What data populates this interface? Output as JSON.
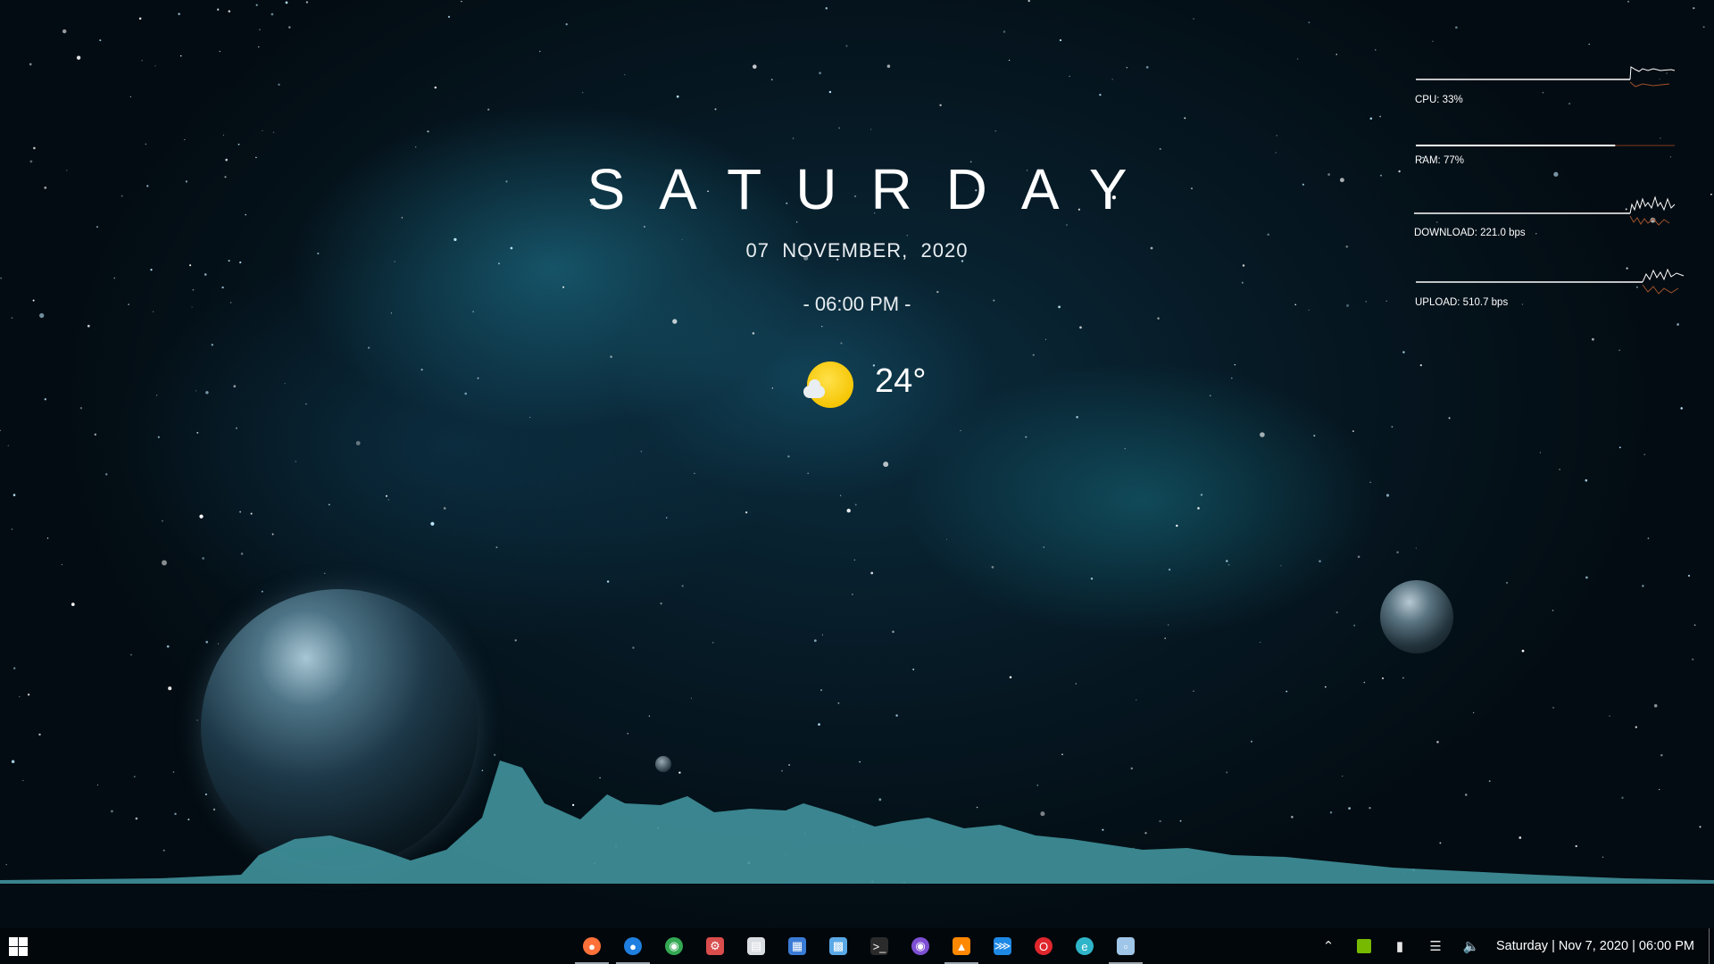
{
  "widget": {
    "day": "SATURDAY",
    "date": "07  NOVEMBER,  2020",
    "time": "- 06:00 PM -",
    "weather": {
      "temperature": "24°",
      "icon": "sun-cloud-icon"
    }
  },
  "system_monitor": [
    {
      "label": "CPU: 33%",
      "value": 33,
      "color": "#ffffff"
    },
    {
      "label": "RAM: 77%",
      "value": 77,
      "color": "#ffffff"
    },
    {
      "label": "DOWNLOAD: 221.0 bps"
    },
    {
      "label": "UPLOAD: 510.7 bps"
    }
  ],
  "taskbar": {
    "apps": [
      {
        "name": "firefox",
        "icon": "firefox-icon",
        "color": "#ff7139",
        "active": true
      },
      {
        "name": "firefox-developer",
        "icon": "firefox-developer-icon",
        "color": "#1f7fe0",
        "active": true
      },
      {
        "name": "chrome",
        "icon": "chrome-icon",
        "color": "#34a853",
        "active": false
      },
      {
        "name": "settings-app",
        "icon": "gear-icon",
        "color": "#d94d4d",
        "active": false
      },
      {
        "name": "notepad",
        "icon": "notepad-icon",
        "color": "#d8dde2",
        "active": false
      },
      {
        "name": "calculator",
        "icon": "calculator-icon",
        "color": "#3a7bd5",
        "active": false
      },
      {
        "name": "control-panel",
        "icon": "control-panel-icon",
        "color": "#5aa9e6",
        "active": false
      },
      {
        "name": "terminal",
        "icon": "terminal-icon",
        "color": "#2b2b2b",
        "active": false
      },
      {
        "name": "tor-browser",
        "icon": "tor-icon",
        "color": "#7e4fd3",
        "active": false
      },
      {
        "name": "vlc",
        "icon": "vlc-icon",
        "color": "#ff8800",
        "active": true
      },
      {
        "name": "vscode",
        "icon": "vscode-icon",
        "color": "#1e88e5",
        "active": false
      },
      {
        "name": "opera",
        "icon": "opera-icon",
        "color": "#e0262d",
        "active": false
      },
      {
        "name": "edge",
        "icon": "edge-icon",
        "color": "#2fb5c9",
        "active": false
      },
      {
        "name": "files",
        "icon": "files-icon",
        "color": "#9fc6e8",
        "active": true
      }
    ],
    "tray": [
      {
        "name": "show-hidden",
        "icon": "chevron-up-icon"
      },
      {
        "name": "nvidia",
        "icon": "nvidia-icon"
      },
      {
        "name": "battery",
        "icon": "battery-icon"
      },
      {
        "name": "network",
        "icon": "wifi-icon"
      },
      {
        "name": "volume",
        "icon": "volume-icon"
      }
    ],
    "clock": "Saturday | Nov 7, 2020 | 06:00 PM"
  }
}
